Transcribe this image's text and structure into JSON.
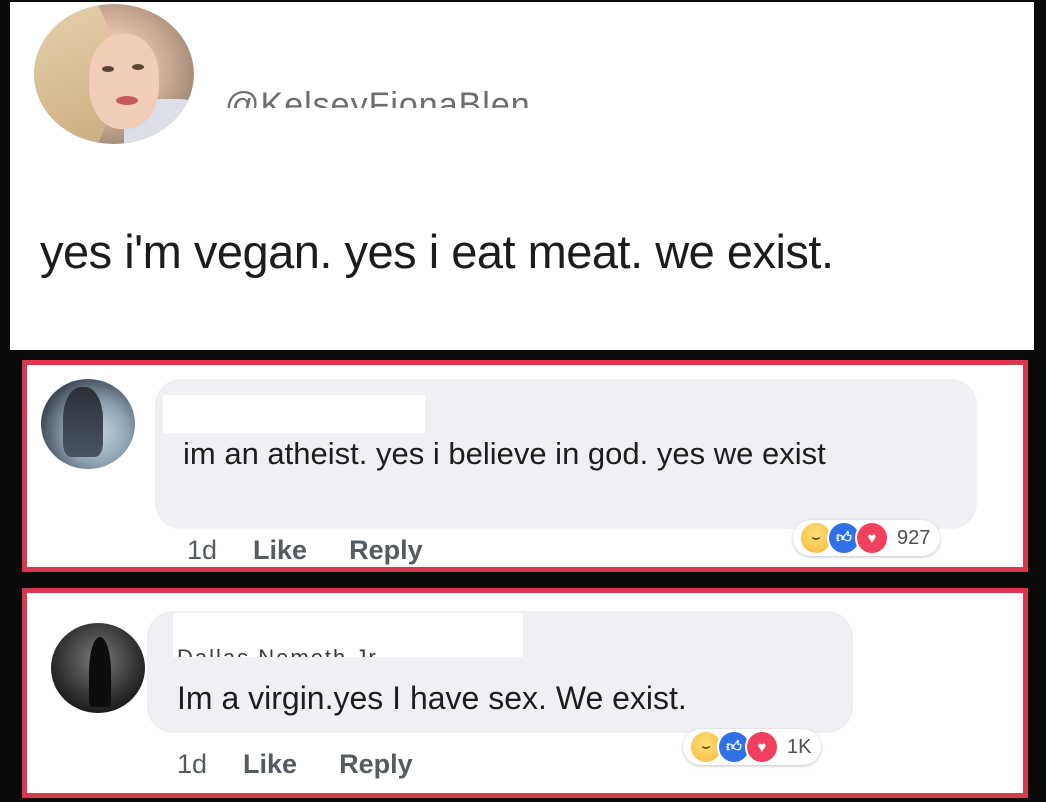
{
  "tweet": {
    "handle": "@KelseyFionaBlen",
    "text": "yes i'm vegan. yes i eat meat. we exist."
  },
  "comments": [
    {
      "text": "im an atheist.  yes i believe in god.  yes we exist",
      "time": "1d",
      "like_label": "Like",
      "reply_label": "Reply",
      "reaction_count": "927"
    },
    {
      "author_partial": "Dallas Nemeth Jr.",
      "text": "Im a virgin.yes I have sex. We exist.",
      "time": "1d",
      "like_label": "Like",
      "reply_label": "Reply",
      "reaction_count": "1K"
    }
  ],
  "reaction_icons": [
    "haha-icon",
    "like-icon",
    "love-icon"
  ],
  "colors": {
    "frame_red": "#d9384f",
    "like_blue": "#2f6fe8",
    "love_red": "#f0405b",
    "bubble_gray": "#eef0f3"
  }
}
